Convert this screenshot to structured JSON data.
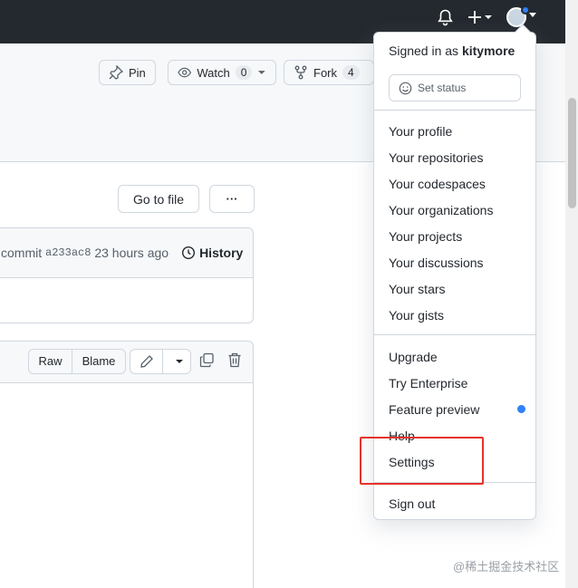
{
  "header": {
    "bell_icon": "bell-icon",
    "plus_icon": "plus-icon",
    "avatar": "user-avatar"
  },
  "repo_actions": {
    "pin_label": "Pin",
    "watch_label": "Watch",
    "watch_count": "0",
    "fork_label": "Fork",
    "fork_count": "4"
  },
  "file_nav": {
    "go_to_file": "Go to file",
    "more": "···"
  },
  "commit": {
    "prefix": "commit",
    "hash": "a233ac8",
    "time": "23 hours ago",
    "history_label": "History"
  },
  "file_toolbar": {
    "raw_label": "Raw",
    "blame_label": "Blame"
  },
  "menu": {
    "signed_in_prefix": "Signed in as",
    "username": "kitymore",
    "set_status": "Set status",
    "group1": [
      "Your profile",
      "Your repositories",
      "Your codespaces",
      "Your organizations",
      "Your projects",
      "Your discussions",
      "Your stars",
      "Your gists"
    ],
    "group2": [
      "Upgrade",
      "Try Enterprise",
      "Feature preview",
      "Help",
      "Settings"
    ],
    "sign_out": "Sign out"
  },
  "watermark": "@稀土掘金技术社区",
  "colors": {
    "topbar": "#24292f",
    "accent_dot": "#2f81f7",
    "highlight": "#e5322b"
  }
}
